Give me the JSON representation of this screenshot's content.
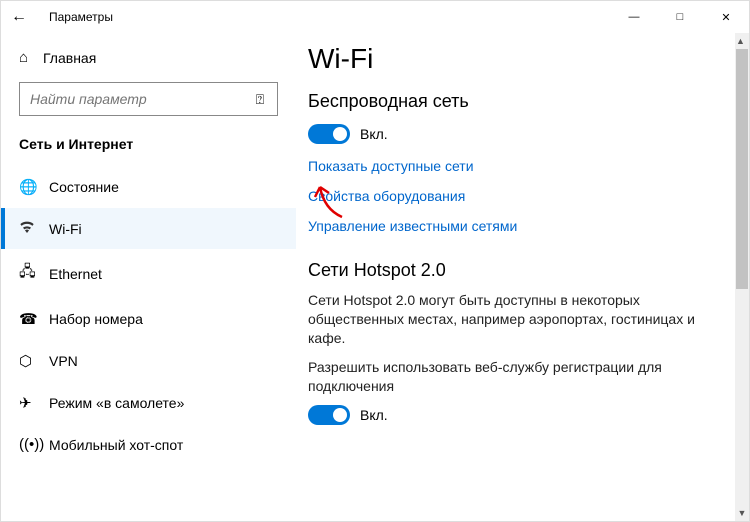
{
  "window": {
    "title": "Параметры"
  },
  "home_label": "Главная",
  "search_placeholder": "Найти параметр",
  "section_title": "Сеть и Интернет",
  "nav": [
    {
      "label": "Состояние"
    },
    {
      "label": "Wi-Fi"
    },
    {
      "label": "Ethernet"
    },
    {
      "label": "Набор номера"
    },
    {
      "label": "VPN"
    },
    {
      "label": "Режим «в самолете»"
    },
    {
      "label": "Мобильный хот-спот"
    }
  ],
  "page": {
    "heading": "Wi-Fi",
    "wireless_heading": "Беспроводная сеть",
    "toggle_on": "Вкл.",
    "link_show_networks": "Показать доступные сети",
    "link_hardware_props": "Свойства оборудования",
    "link_manage_known": "Управление известными сетями",
    "hotspot_heading": "Сети Hotspot 2.0",
    "hotspot_desc": "Сети Hotspot 2.0 могут быть доступны в некоторых общественных местах, например аэропортах, гостиницах и кафе.",
    "hotspot_allow": "Разрешить использовать веб-службу регистрации для подключения",
    "hotspot_toggle": "Вкл."
  }
}
